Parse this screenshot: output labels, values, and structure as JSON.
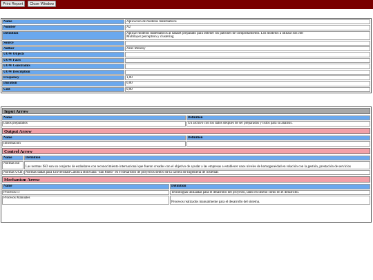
{
  "toolbar": {
    "print_label": "Print Report",
    "close_label": "Close Window"
  },
  "details": [
    {
      "key": "Name",
      "value": "Aplicacion de modelos  matematicos",
      "value2": ""
    },
    {
      "key": "Number",
      "value": "A2",
      "value2": ""
    },
    {
      "key": "Definition",
      "value": "Aplicar modelos matematicos al dataset preparado para obtener los patrones de comportamiento. Los modelos a utilizar son J48",
      "value2": "Multilayer perceptron y clustering"
    },
    {
      "key": "Source",
      "value": "",
      "value2": ""
    },
    {
      "key": "Author",
      "value": "Ariel Monroy",
      "value2": ""
    },
    {
      "key": "UOW Objects",
      "value": "",
      "value2": ""
    },
    {
      "key": "UOW Facts",
      "value": "",
      "value2": ""
    },
    {
      "key": "UOW Constraints",
      "value": "",
      "value2": ""
    },
    {
      "key": "UOW Description",
      "value": "",
      "value2": ""
    },
    {
      "key": "Frequency",
      "value": "1,00",
      "value2": ""
    },
    {
      "key": "Duration",
      "value": "0,00",
      "value2": ""
    },
    {
      "key": "Cost",
      "value": "0,00",
      "value2": ""
    }
  ],
  "input_arrow": {
    "title": "Input Arrow",
    "col_name": "Name",
    "col_definition": "Definition",
    "rows": [
      {
        "name": "Datos preparados",
        "definition": "Un archivo con los datos despues de ser preparados y listos para su analisis."
      }
    ]
  },
  "output_arrow": {
    "title": "Output Arrow",
    "col_name": "Name",
    "col_definition": "Definition",
    "rows": [
      {
        "name": "Informacion",
        "definition": ""
      }
    ]
  },
  "control_arrow": {
    "title": "Control Arrow",
    "col_name": "Name",
    "col_definition": "Definition",
    "rows": [
      {
        "name": "Normas Iso",
        "definition": "Las normas ISO son un conjunto de estándares con reconocimiento internacional que fueron creados con el objetivo de ayudar a las empresas a establecer unos niveles de homogeneidad en relación con la gestión, prestación de servicios"
      },
      {
        "name": "Normas UCB",
        "definition": "Normas dadas para Universidad Católica Boliviana  \"San Pablo\" en el desarrollo de proyectos dentro de la carrera de Ingenieria de Sistemas"
      }
    ]
  },
  "mechanism_arrow": {
    "title": "Mechanism Arrow",
    "col_name": "Name",
    "col_definition": "Definition",
    "rows": [
      {
        "name": "Procesos IT",
        "definition": "Tecnologias utilizadas para el desarrollo del proyecto, tanto en diseño como en el desarrollo."
      },
      {
        "name": "Procesos Manuales",
        "definition": "Procesos realizados manualmente para el desarrollo del sistema."
      }
    ]
  },
  "colors": {
    "topbar": "#7a0000",
    "header_cell": "#6aa8ee",
    "section_gray": "#a8a8a8",
    "section_pink": "#f2a0a8"
  }
}
